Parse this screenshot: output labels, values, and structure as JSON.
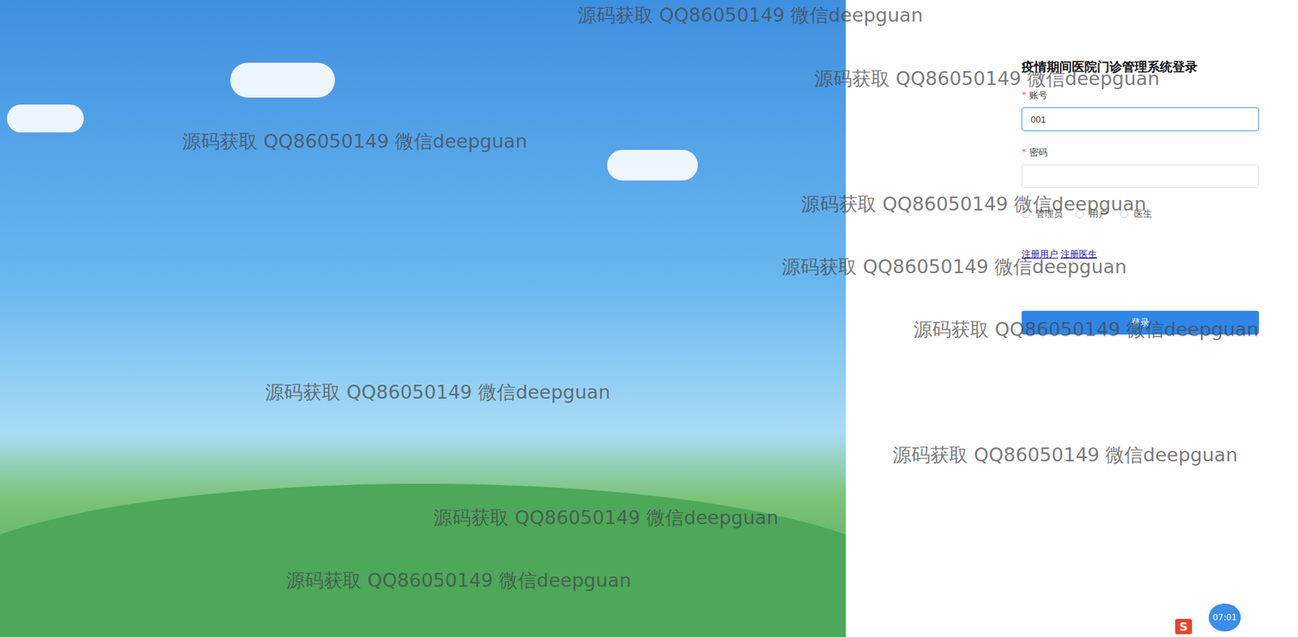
{
  "login": {
    "title": "疫情期间医院门诊管理系统登录",
    "fields": [
      {
        "label": "账号",
        "required_mark": "*",
        "value": "001",
        "focused": true,
        "kind": "text"
      },
      {
        "label": "密码",
        "required_mark": "*",
        "value": "",
        "focused": false,
        "kind": "password"
      }
    ],
    "roles": [
      {
        "label": "管理员",
        "selected": false
      },
      {
        "label": "用户",
        "selected": false
      },
      {
        "label": "医生",
        "selected": false
      }
    ],
    "links": [
      "注册用户",
      "注册医生"
    ],
    "button": "登录"
  },
  "watermarks": [
    "源码获取 QQ86050149 微信deepguan",
    "源码获取 QQ86050149 微信deepguan",
    "源码获取 QQ86050149 微信deepguan",
    "源码获取 QQ86050149 微信deepguan",
    "源码获取 QQ86050149 微信deepguan",
    "源码获取 QQ86050149 微信deepguan",
    "源码获取 QQ86050149 微信deepguan",
    "源码获取 QQ86050149 微信deepguan",
    "源码获取 QQ86050149 微信deepguan",
    "源码获取 QQ86050149 微信deepguan"
  ],
  "recorder": {
    "time": "07:01"
  }
}
